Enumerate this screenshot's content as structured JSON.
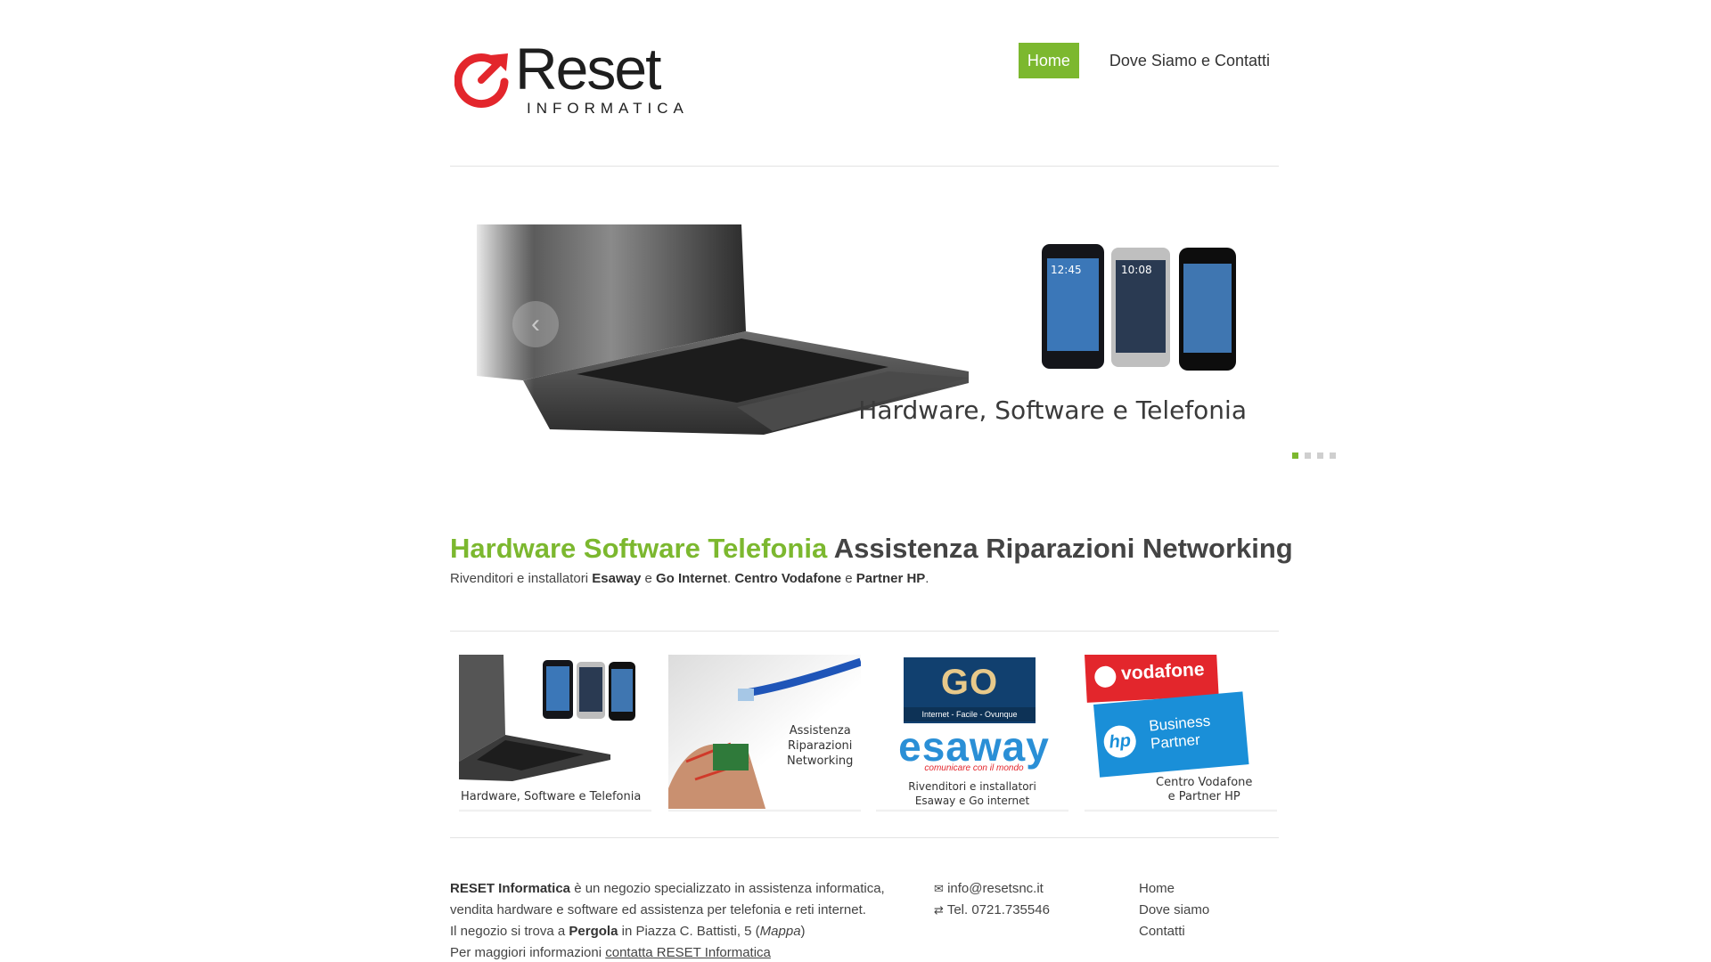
{
  "brand": {
    "logo_word": "Reset",
    "logo_sub": "INFORMATICA",
    "accent": "#7cb82f",
    "logo_red": "#e3262c"
  },
  "nav": {
    "home": "Home",
    "contacts": "Dove Siamo e Contatti"
  },
  "slider": {
    "caption": "Hardware, Software e Telefonia",
    "prev_icon": "chevron-left-icon",
    "active_dot": 1,
    "dot_count": 4,
    "phone_times": [
      "12:45",
      "10:08"
    ]
  },
  "intro": {
    "headline_green": "Hardware Software Telefonia",
    "headline_rest": "Assistenza Riparazioni Networking",
    "p1": "Rivenditori e installatori ",
    "b1": "Esaway",
    "p2": " e ",
    "b2": "Go Internet",
    "p3": ". ",
    "b3": "Centro Vodafone",
    "p4": " e ",
    "b4": "Partner HP",
    "p5": "."
  },
  "tiles": [
    {
      "caption": "Hardware, Software e Telefonia"
    },
    {
      "caption_lines": [
        "Assistenza",
        "Riparazioni",
        "Networking"
      ]
    },
    {
      "go_logo": "GO",
      "go_tagline": "Internet - Facile - Ovunque",
      "esaway_logo": "esaway",
      "esaway_tagline": "comunicare con il mondo",
      "caption_lines": [
        "Rivenditori e installatori",
        "Esaway e Go internet"
      ]
    },
    {
      "vodafone_logo": "vodafone",
      "hp_logo": "hp",
      "hp_text": [
        "Business",
        "Partner"
      ],
      "caption_lines": [
        "Centro Vodafone",
        "e Partner HP"
      ]
    }
  ],
  "footer": {
    "about": {
      "b1": "RESET Informatica",
      "t1": " è un negozio specializzato in assistenza informatica,",
      "t2": "vendita hardware e software ed assistenza per telefonia e reti internet.",
      "t3": "Il negozio si trova a ",
      "b2": "Pergola",
      "t4": " in Piazza C. Battisti, 5 (",
      "map": "Mappa",
      "t5": ")",
      "t6": "Per maggiori informazioni ",
      "link": "contatta RESET Informatica"
    },
    "contact": {
      "email_icon": "envelope-icon",
      "email": "info@resetsnc.it",
      "phone_icon": "phone-icon",
      "phone": "Tel. 0721.735546"
    },
    "links": [
      "Home",
      "Dove siamo",
      "Contatti"
    ]
  }
}
